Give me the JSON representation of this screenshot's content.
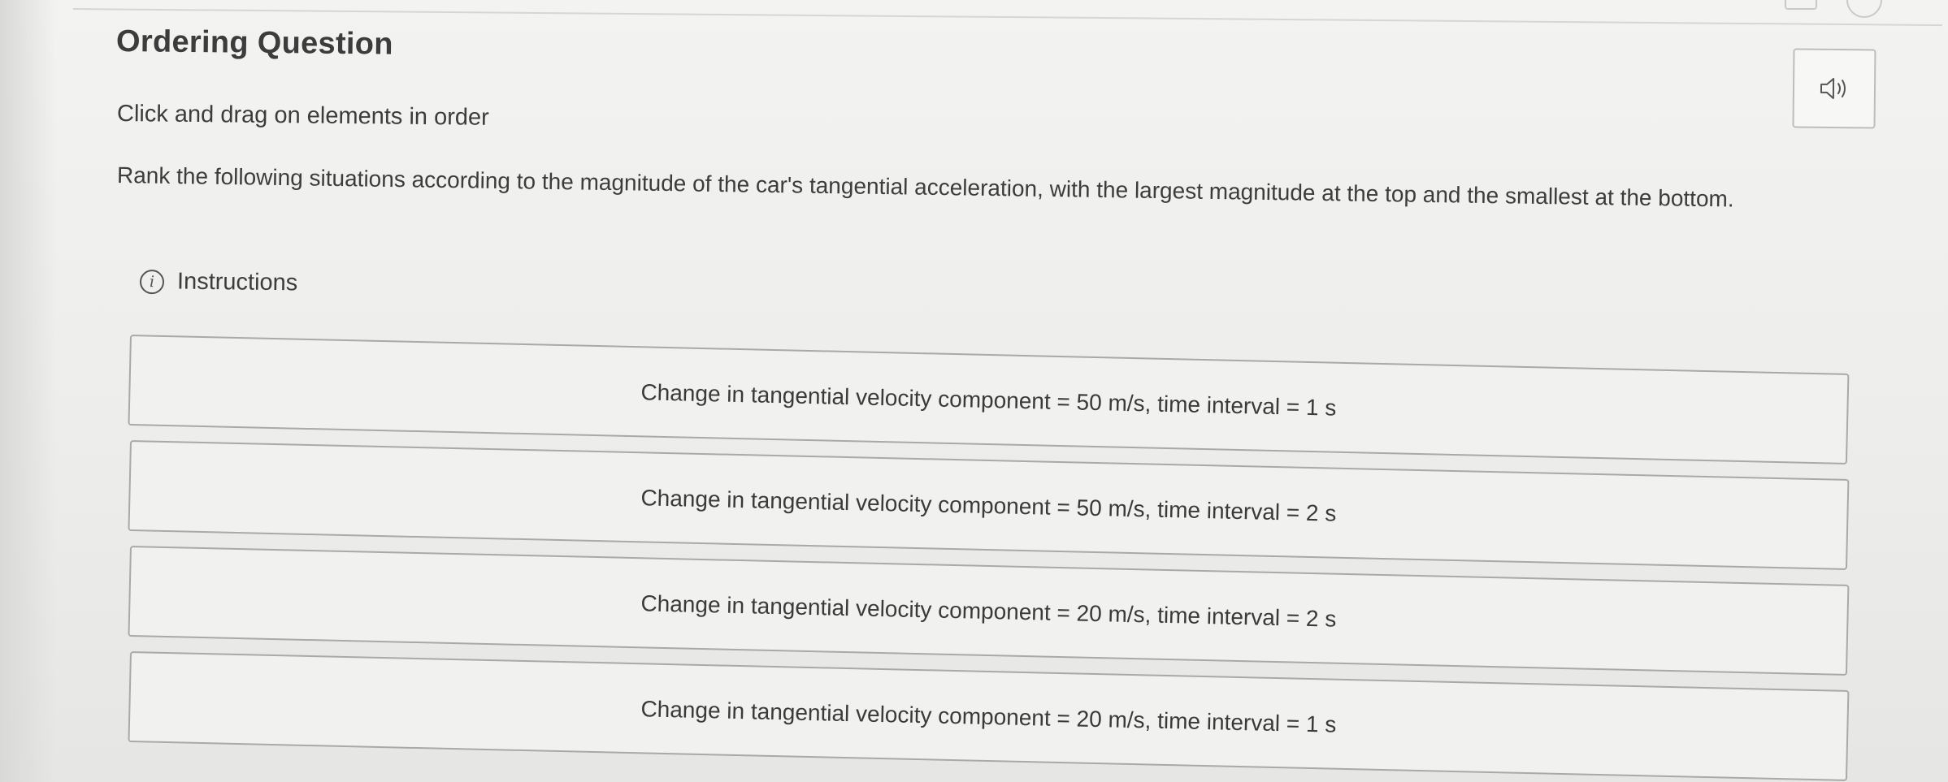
{
  "header": {
    "title": "Ordering Question",
    "subtitle": "Click and drag on elements in order"
  },
  "question": {
    "prompt": "Rank the following situations according to the magnitude of the car's tangential acceleration, with the largest magnitude at the top and the smallest at the bottom."
  },
  "instructions": {
    "icon_glyph": "i",
    "label": "Instructions"
  },
  "audio": {
    "icon": "speaker-icon"
  },
  "items": [
    {
      "text": "Change in tangential velocity component = 50 m/s, time interval = 1 s"
    },
    {
      "text": "Change in tangential velocity component = 50 m/s, time interval = 2 s"
    },
    {
      "text": "Change in tangential velocity component = 20 m/s, time interval = 2 s"
    },
    {
      "text": "Change in tangential velocity component = 20 m/s, time interval = 1 s"
    }
  ]
}
